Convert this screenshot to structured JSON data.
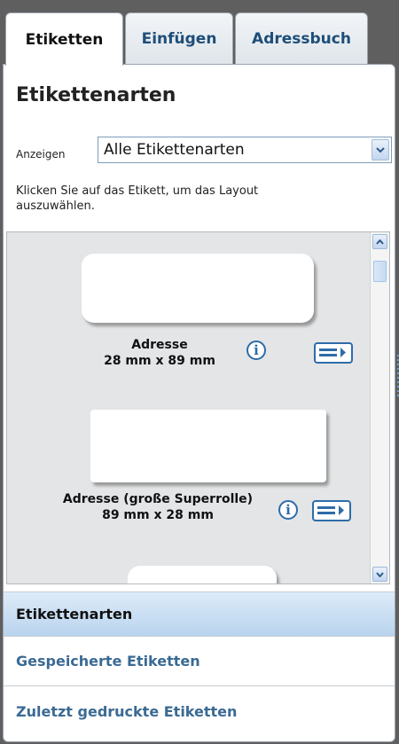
{
  "tabs": [
    {
      "label": "Etiketten"
    },
    {
      "label": "Einfügen"
    },
    {
      "label": "Adressbuch"
    }
  ],
  "panel": {
    "heading": "Etikettenarten",
    "filter": {
      "label": "Anzeigen",
      "value": "Alle Etikettenarten"
    },
    "hint": "Klicken Sie auf das Etikett, um das Layout auszuwählen."
  },
  "labels": [
    {
      "name": "Adresse",
      "size": "28 mm x 89 mm"
    },
    {
      "name": "Adresse (große Superrolle)",
      "size": "89 mm x 28 mm"
    }
  ],
  "nav": [
    {
      "label": "Etikettenarten",
      "active": true
    },
    {
      "label": "Gespeicherte Etiketten",
      "active": false
    },
    {
      "label": "Zuletzt gedruckte Etiketten",
      "active": false
    }
  ],
  "icons": {
    "info": "info-icon",
    "print": "print-arrow-icon",
    "dropdown": "chevron-down-icon",
    "scroll_up": "arrow-up-icon",
    "scroll_down": "arrow-down-icon"
  },
  "colors": {
    "accent": "#2e6ca8",
    "link": "#3a6a93",
    "tab_text": "#1f4e79",
    "nav_active": "#b9d4ee"
  }
}
